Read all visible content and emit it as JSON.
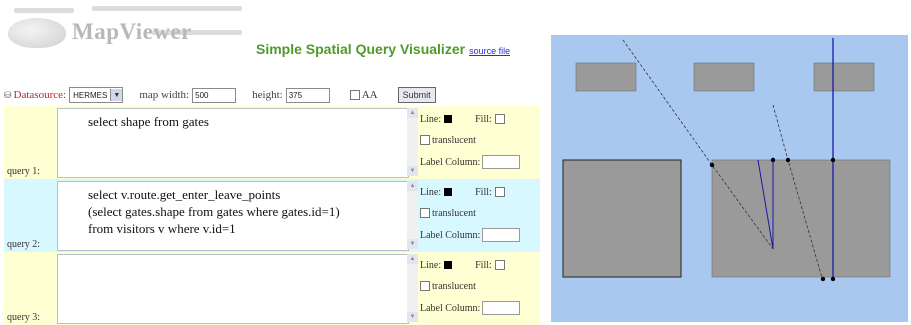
{
  "header": {
    "brand": "MapViewer",
    "title": "Simple Spatial Query Visualizer",
    "source_link": "source file"
  },
  "controls": {
    "datasource_label": "Datasource:",
    "datasource_value": "HERMES",
    "map_width_label": "map width:",
    "map_width_value": "500",
    "height_label": "height:",
    "height_value": "375",
    "aa_label": "AA",
    "submit_label": "Submit"
  },
  "queries": [
    {
      "label": "query 1:",
      "text": "select shape from gates",
      "line_label": "Line:",
      "fill_label": "Fill:",
      "translucent_label": "translucent",
      "label_column_label": "Label Column:"
    },
    {
      "label": "query 2:",
      "text": "select v.route.get_enter_leave_points\n(select gates.shape from gates where gates.id=1)\nfrom visitors v where v.id=1",
      "line_label": "Line:",
      "fill_label": "Fill:",
      "translucent_label": "translucent",
      "label_column_label": "Label Column:"
    },
    {
      "label": "query 3:",
      "text": "",
      "line_label": "Line:",
      "fill_label": "Fill:",
      "translucent_label": "translucent",
      "label_column_label": "Label Column:"
    }
  ],
  "colors": {
    "map_background": "#a8c8f0",
    "shape_fill": "#9a9a9a",
    "route_line": "#1a1aa8",
    "title_green": "#4f9a2e",
    "datasource_red": "#b5262e",
    "row_yellow": "#ffffd4",
    "row_cyan": "#d8f8ff"
  }
}
